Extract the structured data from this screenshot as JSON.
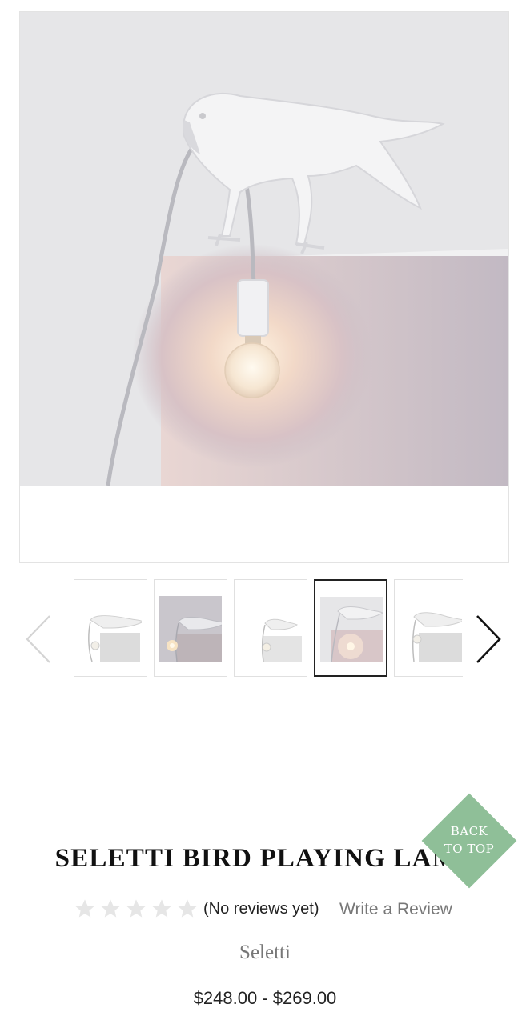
{
  "gallery": {
    "main_image": "seletti-bird-playing-lamp-photo",
    "thumbnail_count": 5,
    "active_thumbnail": 4,
    "prev_icon": "chevron-left-icon",
    "next_icon": "chevron-right-icon"
  },
  "back_to_top": {
    "line1": "BACK",
    "line2": "TO TOP",
    "color": "#8fbf98"
  },
  "product": {
    "title": "SELETTI BIRD PLAYING LAMP",
    "rating_stars": 0,
    "rating_max": 5,
    "reviews_text": "(No reviews yet)",
    "write_review_label": "Write a Review",
    "brand": "Seletti",
    "price": "$248.00 - $269.00"
  }
}
